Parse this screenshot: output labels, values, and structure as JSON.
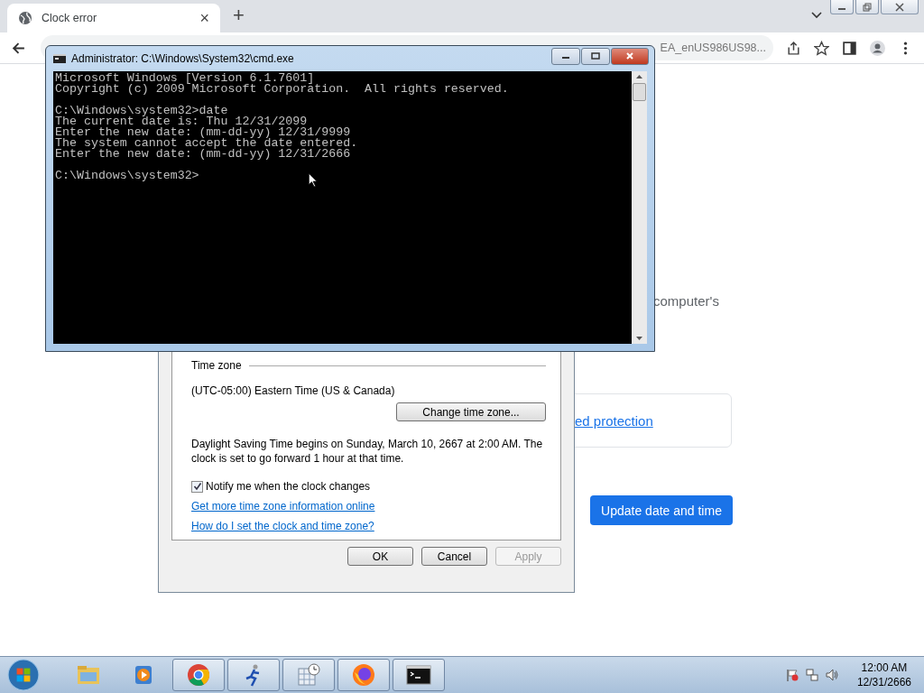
{
  "browser": {
    "tab_title": "Clock error",
    "new_tab": "+",
    "close_tab": "×",
    "address_fragment": "EA_enUS986US98..."
  },
  "page": {
    "text_fragment": "computer's",
    "link_fragment": "ed protection",
    "update_button": "Update date and time"
  },
  "cmd_window": {
    "title": "Administrator: C:\\Windows\\System32\\cmd.exe",
    "blocks": [
      [
        "Microsoft Windows [Version 6.1.7601]",
        "Copyright (c) 2009 Microsoft Corporation.  All rights reserved."
      ],
      [
        "C:\\Windows\\system32>date",
        "The current date is: Thu 12/31/2099",
        "Enter the new date: (mm-dd-yy) 12/31/9999",
        "The system cannot accept the date entered.",
        "Enter the new date: (mm-dd-yy) 12/31/2666"
      ],
      [
        "C:\\Windows\\system32>"
      ]
    ]
  },
  "dialog": {
    "section_title": "Time zone",
    "time_zone": "(UTC-05:00) Eastern Time (US & Canada)",
    "change_button": "Change time zone...",
    "dst_text": "Daylight Saving Time begins on Sunday, March 10, 2667 at 2:00 AM. The clock is set to go forward 1 hour at that time.",
    "notify": {
      "label": "Notify me when the clock changes",
      "checked": true
    },
    "links": [
      "Get more time zone information online",
      "How do I set the clock and time zone?"
    ],
    "buttons": [
      {
        "label": "OK",
        "disabled": false
      },
      {
        "label": "Cancel",
        "disabled": false
      },
      {
        "label": "Apply",
        "disabled": true
      }
    ]
  },
  "taskbar": {
    "apps": [
      {
        "kind": "folder",
        "running": false
      },
      {
        "kind": "media",
        "running": false
      },
      {
        "kind": "chrome",
        "running": true
      },
      {
        "kind": "runner",
        "running": true
      },
      {
        "kind": "calendar",
        "running": true
      },
      {
        "kind": "firefox",
        "running": true
      },
      {
        "kind": "terminal",
        "running": true
      }
    ],
    "clock": {
      "time": "12:00 AM",
      "date": "12/31/2666"
    }
  }
}
